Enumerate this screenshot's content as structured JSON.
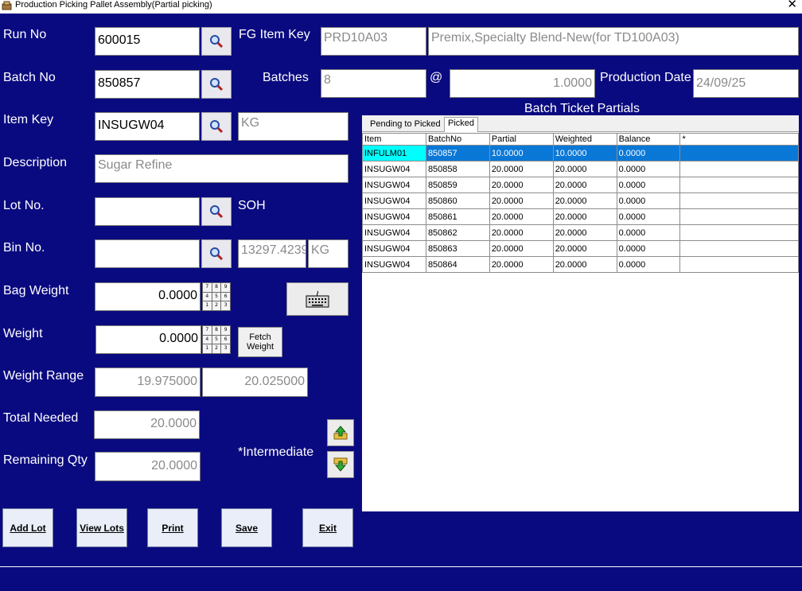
{
  "window": {
    "title": "Production Picking Pallet Assembly(Partial picking)",
    "close_symbol": "✕"
  },
  "labels": {
    "run_no": "Run No",
    "batch_no": "Batch No",
    "item_key": "Item Key",
    "description": "Description",
    "lot_no": "Lot No.",
    "bin_no": "Bin No.",
    "bag_weight": "Bag Weight",
    "weight": "Weight",
    "weight_range": "Weight Range",
    "total_needed": "Total Needed",
    "remaining_qty": "Remaining Qty",
    "fg_item_key": "FG Item Key",
    "batches": "Batches",
    "at": "@",
    "production_date": "Production Date",
    "soh": "SOH",
    "intermediate": "*Intermediate",
    "batch_ticket_partials": "Batch Ticket Partials"
  },
  "fields": {
    "run_no": "600015",
    "batch_no": "850857",
    "item_key": "INSUGW04",
    "uom": "KG",
    "description": "Sugar Refine",
    "lot_no": "",
    "bin_no": "",
    "soh_value": "13297.4239",
    "soh_uom": "KG",
    "bag_weight": "0.0000",
    "weight": "0.0000",
    "weight_min": "19.975000",
    "weight_max": "20.025000",
    "total_needed": "20.0000",
    "remaining_qty": "20.0000",
    "fg_item_key": "PRD10A03",
    "fg_description": "Premix,Specialty Blend-New(for TD100A03)",
    "batches": "8",
    "at_value": "1.0000",
    "production_date": "24/09/25"
  },
  "buttons": {
    "fetch_weight": "Fetch Weight",
    "add_lot": "Add Lot",
    "view_lots": "View Lots",
    "print": "Print",
    "save": "Save",
    "exit": "Exit"
  },
  "keypad_keys": [
    "7",
    "8",
    "9",
    "4",
    "5",
    "6",
    "1",
    "2",
    "3"
  ],
  "grid": {
    "tabs": [
      "Pending to Picked",
      "Picked"
    ],
    "active_tab": "Picked",
    "columns": [
      "Item",
      "BatchNo",
      "Partial",
      "Weighted",
      "Balance",
      "*"
    ],
    "rows": [
      [
        "INFULM01",
        "850857",
        "10.0000",
        "10.0000",
        "0.0000",
        ""
      ],
      [
        "INSUGW04",
        "850858",
        "20.0000",
        "20.0000",
        "0.0000",
        ""
      ],
      [
        "INSUGW04",
        "850859",
        "20.0000",
        "20.0000",
        "0.0000",
        ""
      ],
      [
        "INSUGW04",
        "850860",
        "20.0000",
        "20.0000",
        "0.0000",
        ""
      ],
      [
        "INSUGW04",
        "850861",
        "20.0000",
        "20.0000",
        "0.0000",
        ""
      ],
      [
        "INSUGW04",
        "850862",
        "20.0000",
        "20.0000",
        "0.0000",
        ""
      ],
      [
        "INSUGW04",
        "850863",
        "20.0000",
        "20.0000",
        "0.0000",
        ""
      ],
      [
        "INSUGW04",
        "850864",
        "20.0000",
        "20.0000",
        "0.0000",
        ""
      ]
    ],
    "selected_row": 0
  },
  "colors": {
    "form_bg": "#0a0a80",
    "selection": "#0a78d7",
    "selection_first": "#00ffff"
  },
  "icons": [
    "app-icon",
    "search-icon",
    "keypad-icon",
    "keyboard-icon",
    "arrow-up-icon",
    "arrow-down-icon",
    "close-icon"
  ]
}
